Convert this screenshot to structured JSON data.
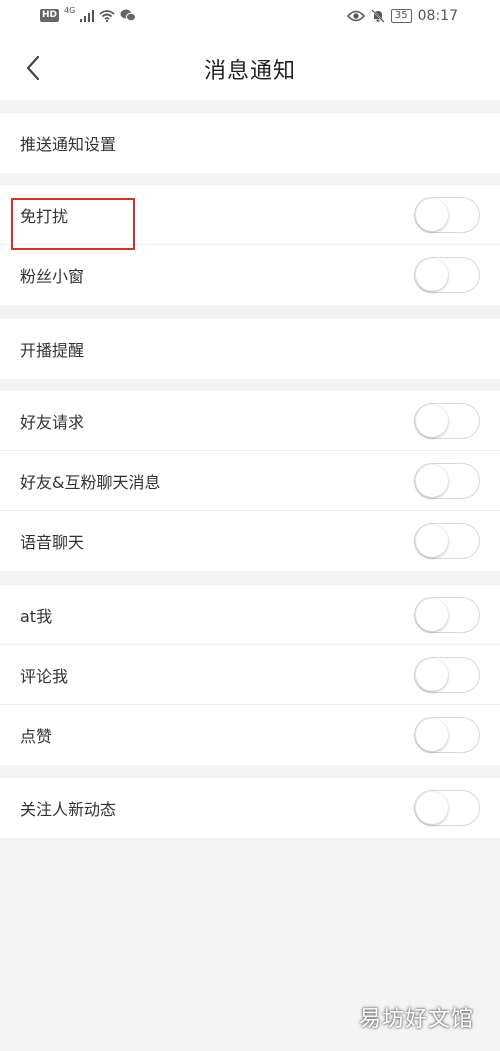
{
  "status_bar": {
    "hd": "HD",
    "network": "4G",
    "battery": "35",
    "time": "08:17",
    "icons": [
      "signal-icon",
      "wifi-icon",
      "wechat-icon",
      "eye-icon",
      "bell-muted-icon",
      "battery-icon"
    ]
  },
  "header": {
    "title": "消息通知",
    "back_icon": "chevron-left-icon"
  },
  "sections": [
    {
      "label": "推送通知设置",
      "has_toggle": false
    },
    {
      "label": "免打扰",
      "has_toggle": true,
      "on": false,
      "highlighted": true
    },
    {
      "label": "粉丝小窗",
      "has_toggle": true,
      "on": false
    },
    {
      "label": "开播提醒",
      "has_toggle": false
    },
    {
      "label": "好友请求",
      "has_toggle": true,
      "on": false
    },
    {
      "label": "好友&互粉聊天消息",
      "has_toggle": true,
      "on": false
    },
    {
      "label": "语音聊天",
      "has_toggle": true,
      "on": false
    },
    {
      "label": "at我",
      "has_toggle": true,
      "on": false
    },
    {
      "label": "评论我",
      "has_toggle": true,
      "on": false
    },
    {
      "label": "点赞",
      "has_toggle": true,
      "on": false
    },
    {
      "label": "关注人新动态",
      "has_toggle": true,
      "on": false
    }
  ],
  "watermark": "易坊好文馆",
  "colors": {
    "background": "#f4f4f4",
    "card": "#ffffff",
    "highlight": "#d0342c",
    "toggle_off": "#ffffff"
  }
}
